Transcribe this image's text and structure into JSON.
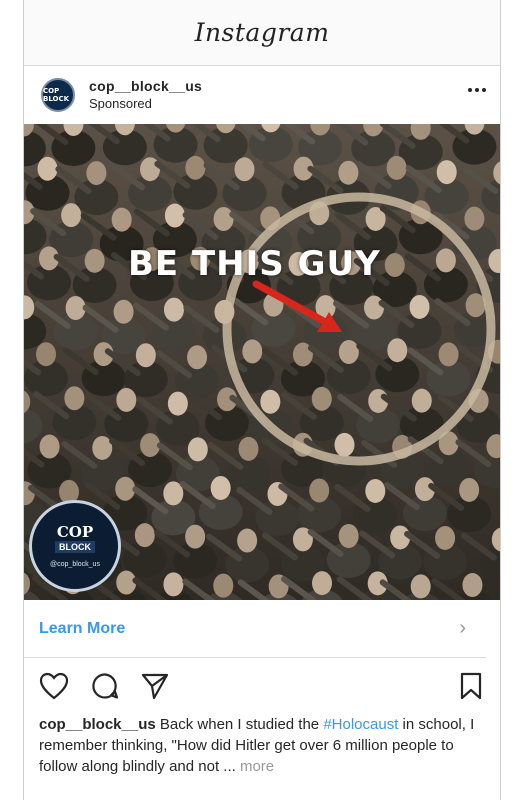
{
  "app": {
    "title": "Instagram"
  },
  "post": {
    "username": "cop__block__us",
    "sponsored_label": "Sponsored",
    "avatar_text": "COP BLOCK",
    "image": {
      "overlay_text": "BE THIS GUY",
      "badge_title": "COP",
      "badge_sub": "BLOCK",
      "badge_handle": "@cop_block_us"
    },
    "cta_label": "Learn More",
    "caption": {
      "user": "cop__block__us",
      "text_before": " Back when I studied the ",
      "hashtag": "#Holocaust",
      "text_after": " in school, I remember thinking, \"How did Hitler get over 6 million people to follow along blindly and not ... ",
      "more": "more"
    }
  },
  "colors": {
    "link": "#3897f0",
    "arrow": "#d8261c",
    "circle": "#c9b9a0"
  }
}
